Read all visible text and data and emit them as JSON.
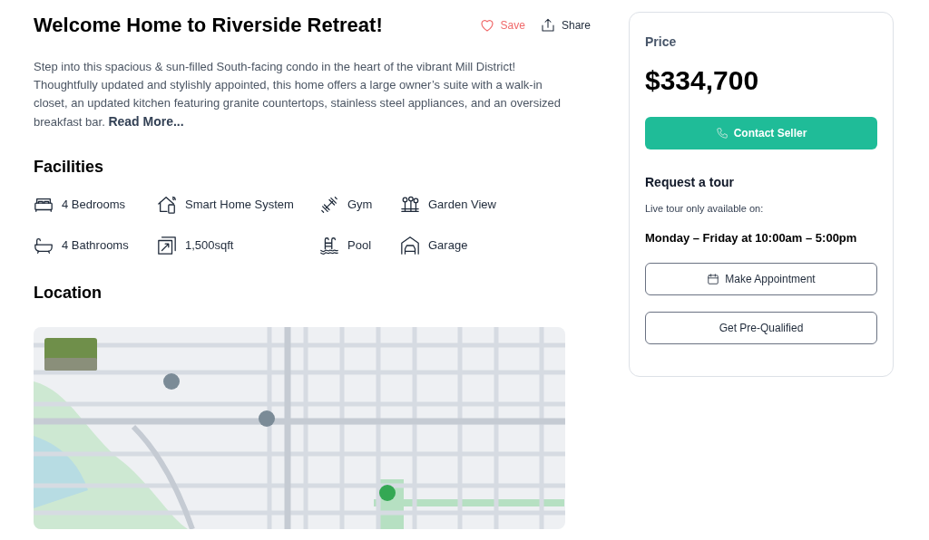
{
  "title": "Welcome Home to Riverside Retreat!",
  "actions": [
    {
      "kind": "save",
      "label": "Save",
      "saved": false
    },
    {
      "kind": "share",
      "label": "Share"
    }
  ],
  "description": "Step into this spacious & sun-filled South-facing condo in the heart of the vibrant Mill District! Thoughtfully updated and stylishly appointed, this home offers a large owner’s suite with a walk-in closet, an updated kitchen featuring granite countertops, stainless steel appliances, and an oversized breakfast bar.",
  "read_more": "Read More...",
  "facilities": {
    "title": "Facilities",
    "items": [
      {
        "kind": "bed",
        "label": "4 Bedrooms"
      },
      {
        "kind": "smart",
        "label": "Smart Home System"
      },
      {
        "kind": "gym",
        "label": "Gym"
      },
      {
        "kind": "garden",
        "label": "Garden View"
      },
      {
        "kind": "bath",
        "label": "4 Bathrooms"
      },
      {
        "kind": "area",
        "label": "1,500sqft"
      },
      {
        "kind": "pool",
        "label": "Pool"
      },
      {
        "kind": "garage",
        "label": "Garage"
      }
    ]
  },
  "location": {
    "title": "Location"
  },
  "price_card": {
    "label": "Price",
    "price": "$334,700",
    "contact_button": "Contact Seller",
    "tour_title": "Request a tour",
    "tour_note": "Live tour only available on:",
    "tour_hours": "Monday – Friday at 10:00am – 5:00pm",
    "buttons": [
      {
        "kind": "appointment",
        "label": "Make Appointment"
      },
      {
        "kind": "plain",
        "label": "Get Pre-Qualified"
      }
    ]
  }
}
